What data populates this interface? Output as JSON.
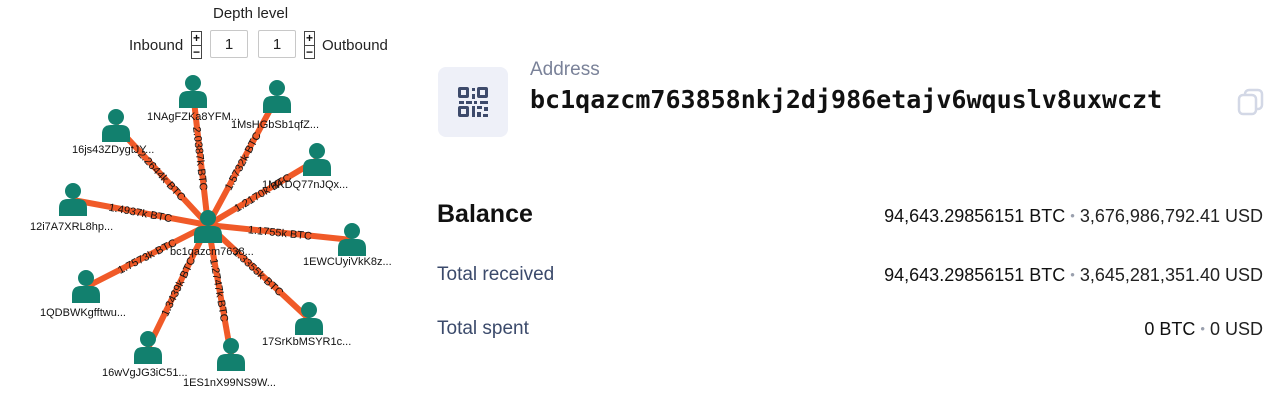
{
  "depth": {
    "title": "Depth level",
    "inbound_label": "Inbound",
    "outbound_label": "Outbound",
    "inbound_value": "1",
    "outbound_value": "1",
    "plus": "+",
    "minus": "−"
  },
  "graph": {
    "center_label": "bc1qazcm7638...",
    "nodes": [
      {
        "label": "1NAgFZKa8YFM..."
      },
      {
        "label": "1MsHGbSb1qfZ..."
      },
      {
        "label": "16js43ZDygtJY..."
      },
      {
        "label": "1MKDQ77nJQx..."
      },
      {
        "label": "12i7A7XRL8hp..."
      },
      {
        "label": "1EWCUyiVkK8z..."
      },
      {
        "label": "1QDBWKgfftwu..."
      },
      {
        "label": "17SrKbMSYR1c..."
      },
      {
        "label": "16wVgJG3iC51..."
      },
      {
        "label": "1ES1nX99NS9W..."
      }
    ],
    "edges": [
      {
        "label": "2.0387k BTC"
      },
      {
        "label": "1.5732k BTC"
      },
      {
        "label": "2.2644k BTC"
      },
      {
        "label": "1.2170k BTC"
      },
      {
        "label": "1.4937k BTC"
      },
      {
        "label": "1.1755k BTC"
      },
      {
        "label": "1.7573k BTC"
      },
      {
        "label": "1.3355k BTC"
      },
      {
        "label": "1.3439k BTC"
      },
      {
        "label": "1.2747k BTC"
      }
    ],
    "colors": {
      "edge": "#f05a28",
      "node": "#12806e"
    }
  },
  "address": {
    "label": "Address",
    "value": "bc1qazcm763858nkj2dj986etajv6wquslv8uxwczt",
    "qr_icon": "qr-code-icon",
    "copy_icon": "copy-icon"
  },
  "stats": {
    "balance": {
      "label": "Balance",
      "btc": "94,643.29856151 BTC",
      "usd": "3,676,986,792.41 USD"
    },
    "received": {
      "label": "Total received",
      "btc": "94,643.29856151 BTC",
      "usd": "3,645,281,351.40 USD"
    },
    "spent": {
      "label": "Total spent",
      "btc": "0 BTC",
      "usd": "0 USD"
    },
    "separator": "•"
  }
}
